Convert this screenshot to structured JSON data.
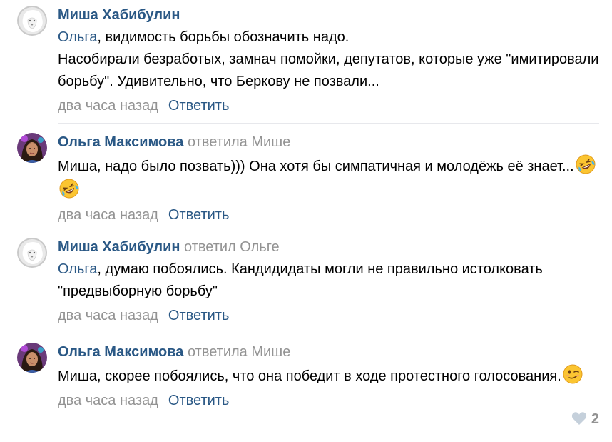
{
  "comments": [
    {
      "author": "Миша Хабибулин",
      "reply_info": "",
      "mention": "Ольга",
      "text_lines": [
        ", видимость борьбы обозначить надо.",
        "Насобирали безработых, замнач помойки, депутатов, которые уже \"имитировали борьбу\". Удивительно, что Беркову не позвали..."
      ],
      "date": "два часа назад",
      "reply_label": "Ответить",
      "avatar_icon": "white-lion-avatar-icon"
    },
    {
      "author": "Ольга Максимова",
      "reply_info": "ответила Мише",
      "mention": "",
      "text": "Миша, надо было позвать))) Она хотя бы симпатичная и молодёжь её знает...",
      "emojis": [
        "rolling-on-floor-laughing-emoji",
        "rolling-on-floor-laughing-emoji"
      ],
      "date": "два часа назад",
      "reply_label": "Ответить",
      "avatar_icon": "woman-avatar-icon"
    },
    {
      "author": "Миша Хабибулин",
      "reply_info": "ответил Ольге",
      "mention": "Ольга",
      "text": ", думаю побоялись. Кандидидаты могли не правильно истолковать \"предвыборную борьбу\"",
      "date": "два часа назад",
      "reply_label": "Ответить",
      "avatar_icon": "white-lion-avatar-icon"
    },
    {
      "author": "Ольга Максимова",
      "reply_info": "ответила Мише",
      "mention": "",
      "text": "Миша, скорее побоялись, что она победит в ходе протестного голосования.",
      "emojis": [
        "winking-face-emoji"
      ],
      "date": "два часа назад",
      "reply_label": "Ответить",
      "avatar_icon": "woman-avatar-icon",
      "likes": "2",
      "like_icon": "heart-icon"
    }
  ],
  "colors": {
    "link": "#2a5885",
    "muted": "#939393",
    "divider": "#e7e8ec"
  }
}
